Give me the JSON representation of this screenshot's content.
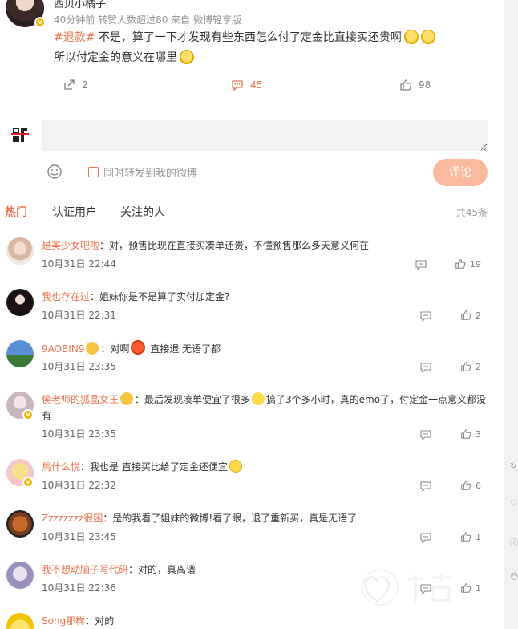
{
  "post": {
    "author": "西贝小橘子",
    "meta": "40分钟前 转赞人数超过80  来自 微博轻享版",
    "tag": "#退款#",
    "line1": " 不是，算了一下才发现有些东西怎么付了定金比直接买还贵啊",
    "line2": "所以付定金的意义在哪里",
    "repost_count": "2",
    "comment_count": "45",
    "like_count": "98"
  },
  "composer": {
    "placeholder": "",
    "also_repost_label": "同时转发到我的微博",
    "submit_label": "评论"
  },
  "tabs": {
    "hot": "热门",
    "verified": "认证用户",
    "following": "关注的人",
    "total": "共45条"
  },
  "comments": [
    {
      "user": "是美少女吧啦",
      "text": "：对，预售比现在直接买凑单还贵，不懂预售那么多天意义何在",
      "time": "10月31日 22:44",
      "likes": "19"
    },
    {
      "user": "我也存在过",
      "text": "：姐妹你是不是算了实付加定金?",
      "time": "10月31日 22:31",
      "likes": "2"
    },
    {
      "user": "9AOBIN9",
      "text_a": "：对啊",
      "text_b": "直接退 无语了都",
      "time": "10月31日 23:35",
      "likes": "2"
    },
    {
      "user": "侯老师的狐晶女王",
      "text_a": "：最后发现凑单便宜了很多",
      "text_b": "搞了3个多小时，真的emo了，付定金一点意义都没有",
      "time": "10月31日 23:35",
      "likes": "3"
    },
    {
      "user": "馬什么悦",
      "text": "：我也是 直接买比给了定金还便宜",
      "time": "10月31日 22:32",
      "likes": "6"
    },
    {
      "user": "Zzzzzzzz很困",
      "text": "：是的我看了姐妹的微博!看了眼，退了重新买，真是无语了",
      "time": "10月31日 23:45",
      "likes": "1"
    },
    {
      "user": "我不想动脑子写代码",
      "text": "：对的，真离谱",
      "time": "10月31日 22:36",
      "likes": "1"
    },
    {
      "user": "Song那样",
      "text": "：对的",
      "time": "",
      "likes": ""
    }
  ],
  "colors": {
    "accent": "#eb7350",
    "submit_bg": "#fbb99d"
  }
}
